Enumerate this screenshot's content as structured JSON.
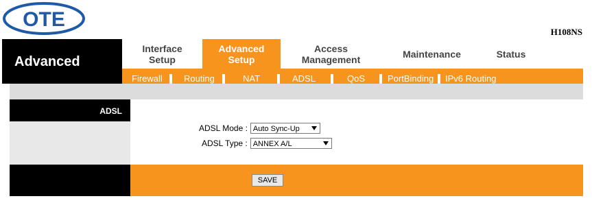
{
  "brand": {
    "logo_text": "OTE",
    "model": "H108NS",
    "section": "Advanced"
  },
  "main_nav": [
    {
      "label": "Interface\nSetup",
      "active": false
    },
    {
      "label": "Advanced\nSetup",
      "active": true
    },
    {
      "label": "Access\nManagement",
      "active": false
    },
    {
      "label": "Maintenance",
      "active": false
    },
    {
      "label": "Status",
      "active": false
    }
  ],
  "sub_nav": [
    "Firewall",
    "Routing",
    "NAT",
    "ADSL",
    "QoS",
    "PortBinding",
    "IPv6 Routing"
  ],
  "content": {
    "section_title": "ADSL",
    "adsl_mode": {
      "label": "ADSL Mode :",
      "value": "Auto Sync-Up"
    },
    "adsl_type": {
      "label": "ADSL Type :",
      "value": "ANNEX A/L"
    }
  },
  "actions": {
    "save_label": "SAVE"
  },
  "colors": {
    "accent": "#f7941d",
    "dark": "#000000",
    "panel": "#e8e8e8",
    "logo_blue": "#1e5aa8"
  }
}
